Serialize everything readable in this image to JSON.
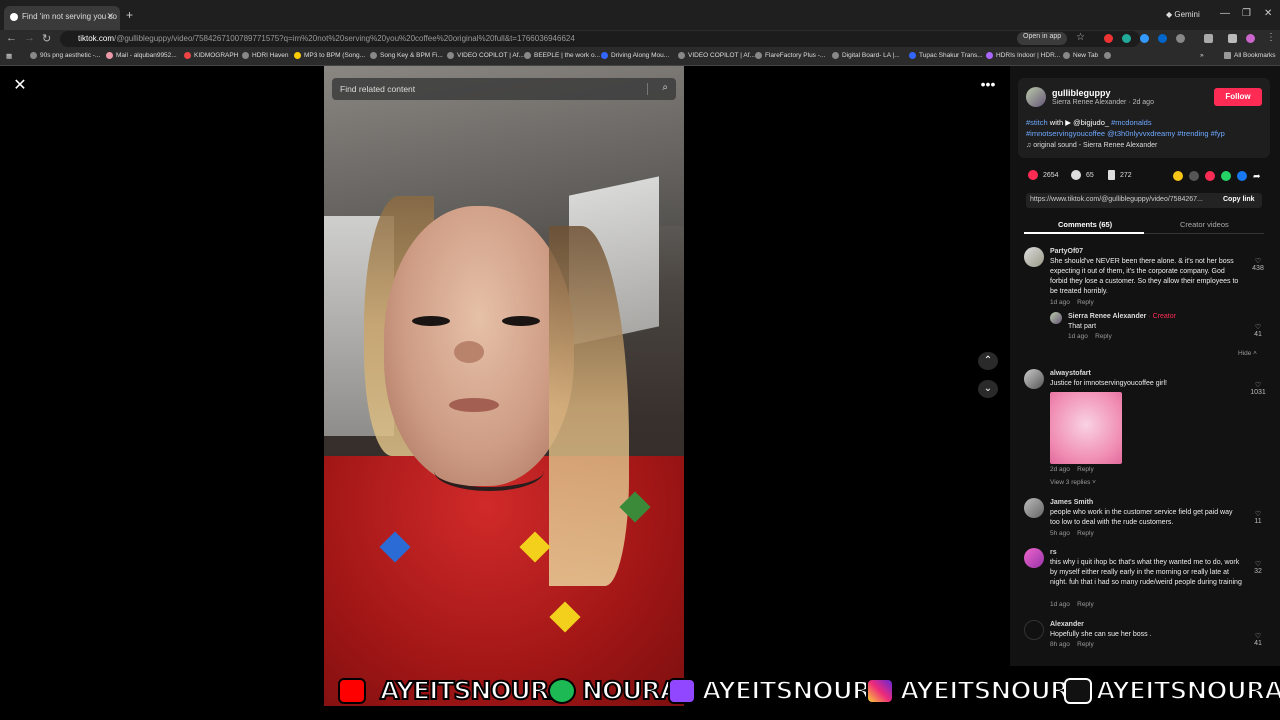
{
  "browser": {
    "tab_title": "Find 'im not serving you co",
    "profile_label": "Gemini",
    "url_domain": "tiktok.com",
    "url_rest": "/@gullibleguppy/video/7584267100789771575?q=im%20not%20serving%20you%20coffee%20original%20full&t=1766036946624",
    "open_in_app": "Open in app",
    "bookmarks": [
      "90s png aesthetic -...",
      "Mail - alquban9952...",
      "KIDMOGRAPH",
      "HDRI Haven",
      "MP3 to BPM (Song...",
      "Song Key & BPM Fi...",
      "VIDEO COPILOT | Af...",
      "BEEPLE | the work o...",
      "Driving Along Mou...",
      "VIDEO COPILOT | Af...",
      "FlareFactory Plus -...",
      "Digital Board- LA |...",
      "Tupac Shakur Trans...",
      "HDRIs Indoor | HDR...",
      "New Tab"
    ],
    "all_bookmarks": "All Bookmarks"
  },
  "video": {
    "search_placeholder": "Find related content"
  },
  "post": {
    "username": "gullibleguppy",
    "display_name": "Sierra Renee Alexander",
    "age": "2d ago",
    "follow": "Follow",
    "caption_stitch": "#stitch",
    "caption_with": "with",
    "caption_user": "▶ @bigjudo_",
    "caption_tags1": "#mcdonalds",
    "caption_tags2": "#imnotservingyoucoffee @t3h0nlyvvxdreamy #trending #fyp",
    "sound": "original sound - Sierra Renee Alexander",
    "likes": "2654",
    "comments_count": "65",
    "saves": "272",
    "link": "https://www.tiktok.com/@gullibleguppy/video/7584267...",
    "copy_link": "Copy link",
    "tab_comments": "Comments (65)",
    "tab_creator": "Creator videos"
  },
  "comments": [
    {
      "name": "PartyOf07",
      "text": "She should've NEVER been there alone. & it's not her boss expecting it out of them, it's the corporate company. God forbid they lose a customer. So they allow their employees to be treated horribly.",
      "age": "1d ago",
      "reply": "Reply",
      "likes": "438"
    },
    {
      "name": "Sierra Renee Alexander",
      "creator": "· Creator",
      "text": "That part",
      "age": "1d ago",
      "reply": "Reply",
      "likes": "41",
      "hide": "Hide ˄"
    },
    {
      "name": "alwaystofart",
      "text": "Justice for imnotservingyoucoffee girl!",
      "age": "2d ago",
      "reply": "Reply",
      "likes": "1031",
      "view_replies": "View 3 replies ˅"
    },
    {
      "name": "James Smith",
      "text": "people who work in the customer service field get paid way too low to deal with the rude customers.",
      "age": "5h ago",
      "reply": "Reply",
      "likes": "11"
    },
    {
      "name": "rs",
      "text": "this why i quit ihop bc that's what they wanted me to do, work by myself either really early in the morning or really late at night. fuh that i had so many rude/weird people during training",
      "age": "1d ago",
      "reply": "Reply",
      "likes": "32"
    },
    {
      "name": "Alexander",
      "text": "Hopefully she can sue her boss .",
      "age": "8h ago",
      "reply": "Reply",
      "likes": "41"
    }
  ],
  "banner": {
    "youtube": "AYEITSNOURA",
    "spotify": "NOURA",
    "twitch": "AYEITSNOURA",
    "instagram": "AYEITSNOURA",
    "tiktok": "AYEITSNOURA"
  },
  "colors": {
    "follow": "#fe2c55",
    "tag": "#6ea8ff",
    "creator": "#fe2c55"
  }
}
